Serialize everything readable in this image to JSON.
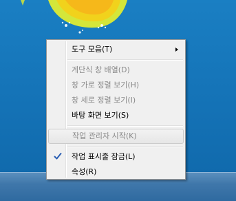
{
  "context_menu": {
    "items": [
      {
        "label": "도구 모음(T)",
        "enabled": true,
        "submenu": true
      },
      {
        "label": "계단식 창 배열(D)",
        "enabled": false
      },
      {
        "label": "창 가로 정렬 보기(H)",
        "enabled": false
      },
      {
        "label": "창 세로 정렬 보기(I)",
        "enabled": false
      },
      {
        "label": "바탕 화면 보기(S)",
        "enabled": true
      },
      {
        "label": "작업 관리자 시작(K)",
        "enabled": false,
        "highlighted": true
      },
      {
        "label": "작업 표시줄 잠금(L)",
        "enabled": true,
        "checked": true
      },
      {
        "label": "속성(R)",
        "enabled": true
      }
    ],
    "icons": {
      "submenu_arrow": "chevron-right-icon",
      "checked_mark": "checkmark-icon"
    }
  },
  "colors": {
    "desktop_blue": "#1574b8",
    "check_blue": "#2b5fb4",
    "disabled_text": "#8a8a8a"
  }
}
